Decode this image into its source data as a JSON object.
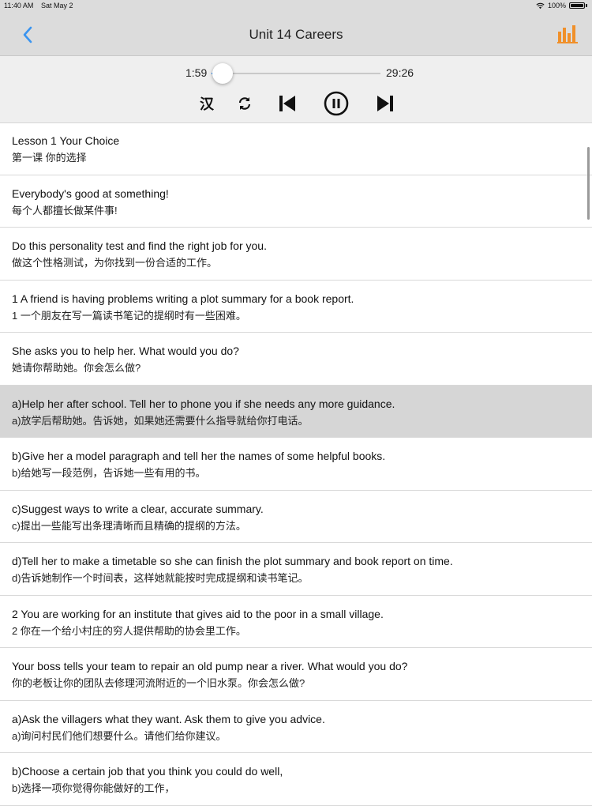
{
  "status": {
    "time": "11:40 AM",
    "date": "Sat May 2",
    "battery": "100%"
  },
  "nav": {
    "title": "Unit 14 Careers",
    "back_icon": "chevron-left-icon",
    "chart_icon": "bar-chart-icon",
    "accent": "#3a94f0",
    "chart_color": "#f0902a"
  },
  "player": {
    "elapsed": "1:59",
    "total": "29:26",
    "progress": 0.067,
    "lang_label": "汉"
  },
  "lessons": [
    {
      "en": "Lesson 1 Your Choice",
      "zh": "第一课 你的选择"
    },
    {
      "en": "Everybody's good at something!",
      "zh": "每个人都擅长做某件事!"
    },
    {
      "en": "Do this personality test and find the right job for you.",
      "zh": "做这个性格测试，为你找到一份合适的工作。"
    },
    {
      "en": "1 A friend is having problems writing a plot summary for a book report.",
      "zh": "1 一个朋友在写一篇读书笔记的提纲时有一些困难。"
    },
    {
      "en": "She asks you to help her. What would you do?",
      "zh": "她请你帮助她。你会怎么做?"
    },
    {
      "en": "a)Help her after school. Tell her to phone you if she needs any more guidance.",
      "zh": "a)放学后帮助她。告诉她，如果她还需要什么指导就给你打电话。"
    },
    {
      "en": "b)Give her a model paragraph and tell her the names of some helpful books.",
      "zh": "b)给她写一段范例，告诉她一些有用的书。"
    },
    {
      "en": "c)Suggest ways to write a clear, accurate summary.",
      "zh": "c)提出一些能写出条理清晰而且精确的提纲的方法。"
    },
    {
      "en": "d)Tell her to make a timetable so she can finish the plot summary and book report on time.",
      "zh": "d)告诉她制作一个时间表，这样她就能按时完成提纲和读书笔记。"
    },
    {
      "en": "2 You are working for an institute that gives aid to the poor in a small village.",
      "zh": "2 你在一个给小村庄的穷人提供帮助的协会里工作。"
    },
    {
      "en": "Your boss tells your team to repair an old pump near a river. What would you do?",
      "zh": "你的老板让你的团队去修理河流附近的一个旧水泵。你会怎么做?"
    },
    {
      "en": "a)Ask the villagers what they want. Ask them to give you advice.",
      "zh": "a)询问村民们他们想要什么。请他们给你建议。"
    },
    {
      "en": "b)Choose a certain job that you think you could do well,",
      "zh": "b)选择一项你觉得你能做好的工作，"
    }
  ]
}
